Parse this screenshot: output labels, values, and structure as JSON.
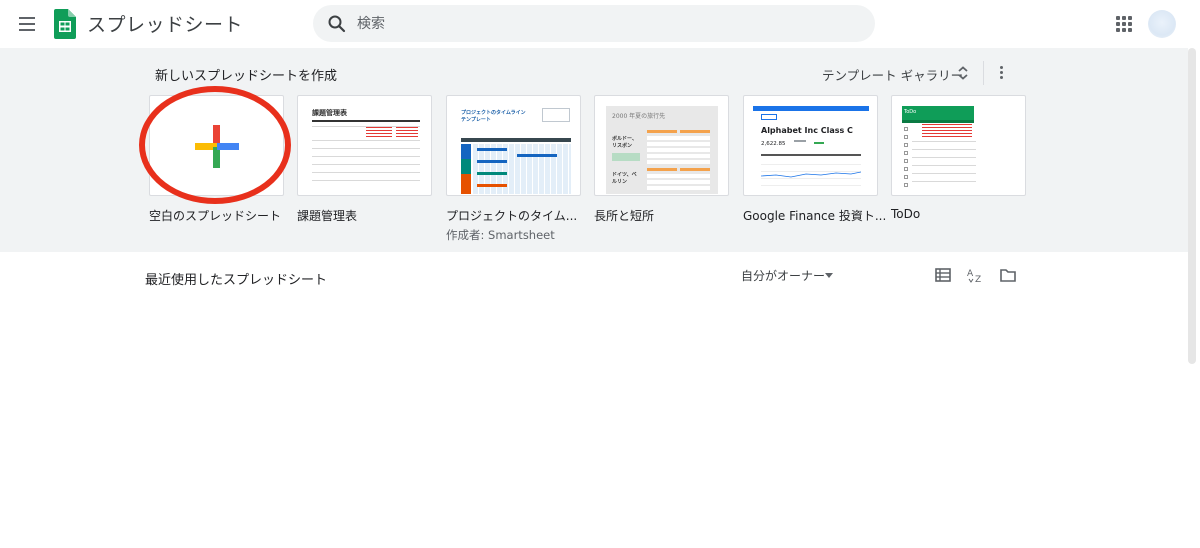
{
  "header": {
    "app_title": "スプレッドシート",
    "search_placeholder": "検索",
    "icons": [
      "menu-icon",
      "sheets-logo",
      "search-icon",
      "apps-grid-icon",
      "account-avatar"
    ]
  },
  "templates": {
    "section_title": "新しいスプレッドシートを作成",
    "gallery_label": "テンプレート ギャラリー",
    "items": [
      {
        "name": "空白のスプレッドシート",
        "subtitle": ""
      },
      {
        "name": "課題管理表",
        "subtitle": ""
      },
      {
        "name": "プロジェクトのタイム...",
        "subtitle": "作成者: Smartsheet"
      },
      {
        "name": "長所と短所",
        "subtitle": ""
      },
      {
        "name": "Google Finance 投資ト...",
        "subtitle": ""
      },
      {
        "name": "ToDo",
        "subtitle": ""
      }
    ],
    "thumbs": {
      "issue_title": "課題管理表",
      "project_title": "プロジェクトのタイムライン テンプレート",
      "pros_title": "2000 年夏の旅行先",
      "pros_cities": [
        "ボルドー、リスボン",
        "ドイツ、ベルリン"
      ],
      "finance_title": "Alphabet Inc Class C",
      "finance_price": "2,622.85",
      "todo_title": "ToDo"
    }
  },
  "recent": {
    "title": "最近使用したスプレッドシート",
    "owner_filter": "自分がオーナー",
    "icons": [
      "list-view-icon",
      "sort-az-icon",
      "folder-icon"
    ]
  },
  "colors": {
    "sheets_green": "#0f9d58",
    "plus_blue": "#4285f4",
    "plus_red": "#ea4335",
    "plus_yellow": "#fbbc04",
    "plus_green": "#34a853",
    "annotation_red": "#e8301c"
  }
}
